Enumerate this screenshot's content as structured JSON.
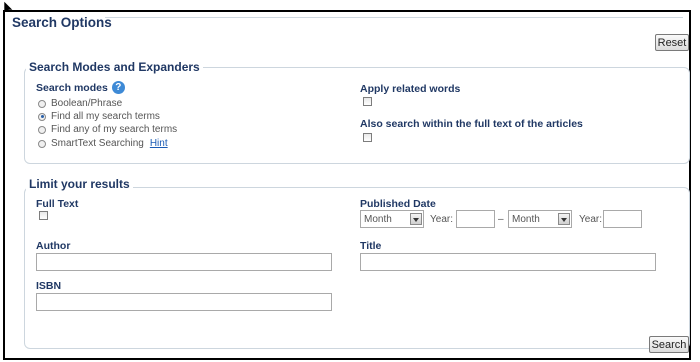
{
  "page": {
    "title": "Search Options",
    "reset_label": "Reset",
    "search_label": "Search"
  },
  "modes": {
    "legend": "Search Modes and Expanders",
    "label": "Search modes",
    "options": [
      "Boolean/Phrase",
      "Find all my search terms",
      "Find any of my search terms",
      "SmartText Searching"
    ],
    "selected": "Find all my search terms",
    "hint": "Hint",
    "related_label": "Apply related words",
    "fulltext_search_label": "Also search within the full text of the articles"
  },
  "limit": {
    "legend": "Limit your results",
    "full_text_label": "Full Text",
    "published_label": "Published Date",
    "month_placeholder": "Month",
    "year_label": "Year:",
    "dash": "–",
    "author_label": "Author",
    "title_label": "Title",
    "isbn_label": "ISBN"
  },
  "colors": {
    "heading": "#203864",
    "link": "#1a5bb5",
    "border": "#cdd6de"
  },
  "icons": [
    "arrow-cursor-icon",
    "help-icon",
    "dropdown-arrow-icon"
  ]
}
